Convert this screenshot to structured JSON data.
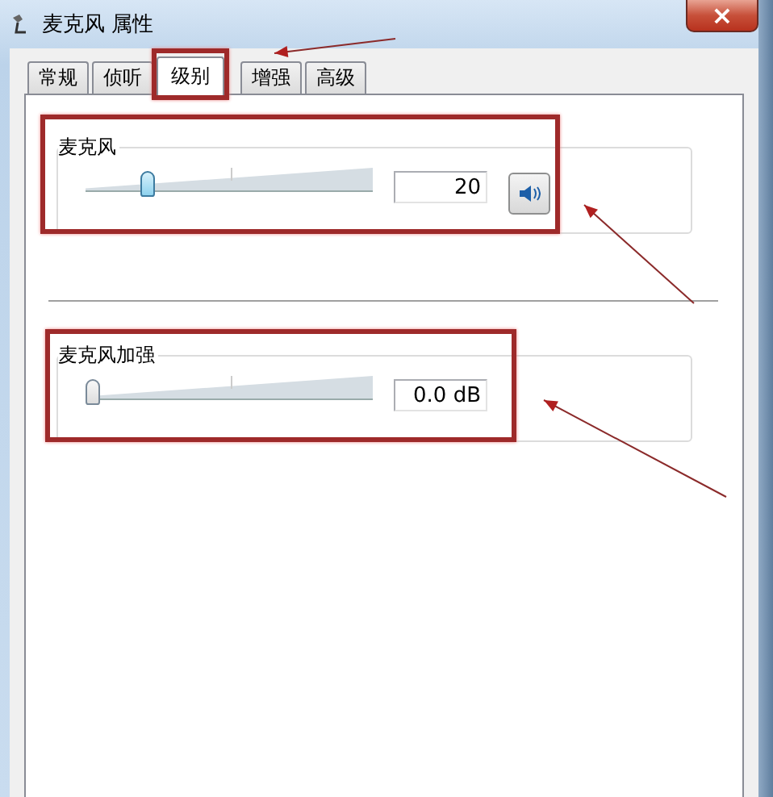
{
  "window": {
    "title": "麦克风 属性",
    "close": "×"
  },
  "tabs": [
    {
      "label": "常规",
      "selected": false,
      "highlight": false
    },
    {
      "label": "侦听",
      "selected": false,
      "highlight": false
    },
    {
      "label": "级别",
      "selected": true,
      "highlight": true
    },
    {
      "label": "增强",
      "selected": false,
      "highlight": false
    },
    {
      "label": "高级",
      "selected": false,
      "highlight": false
    }
  ],
  "groups": [
    {
      "label": "麦克风",
      "level": 0.2,
      "value": "20",
      "mute_button": true,
      "highlight": true
    },
    {
      "label": "麦克风加强",
      "level": 0,
      "value": "0.0 dB",
      "mute_button": false,
      "highlight": true
    }
  ]
}
